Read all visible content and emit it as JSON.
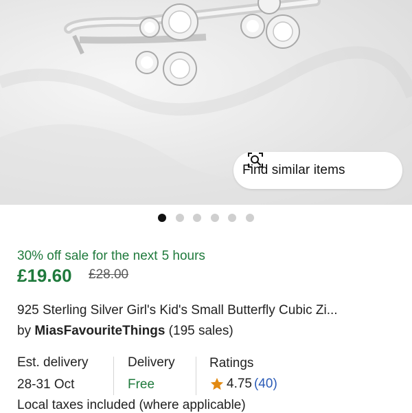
{
  "product_image": {
    "alt": "Silver ring with cubic zirconia butterflies",
    "find_similar_label": "Find similar items",
    "gallery_count": 6,
    "gallery_active_index": 0
  },
  "sale": {
    "text": "30% off sale for the next",
    "hours": "5 hours"
  },
  "price": {
    "current": "£19.60",
    "original": "£28.00"
  },
  "listing": {
    "title": "925 Sterling Silver Girl's Kid's Small Butterfly Cubic Zi...",
    "by": "by",
    "shop_name": "MiasFavouriteThings",
    "sales": "(195 sales)"
  },
  "info": {
    "delivery_est_label": "Est. delivery",
    "delivery_est_value": "28-31 Oct",
    "delivery_label": "Delivery",
    "delivery_value": "Free",
    "ratings_label": "Ratings",
    "rating_value": "4.75",
    "rating_count": "(40)"
  },
  "taxes_note": "Local taxes included (where applicable)",
  "colors": {
    "sale_green": "#1f7a3c",
    "link_blue": "#2a5bb7",
    "star_orange": "#e28a12"
  }
}
